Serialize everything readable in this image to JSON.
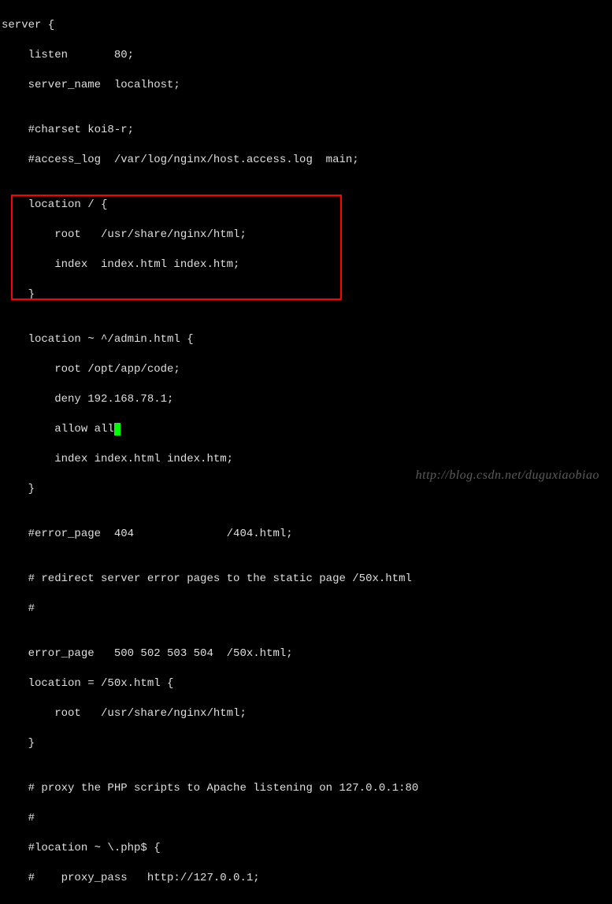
{
  "code": {
    "l01": "server {",
    "l02": "    listen       80;",
    "l03": "    server_name  localhost;",
    "l04": "",
    "l05": "    #charset koi8-r;",
    "l06": "    #access_log  /var/log/nginx/host.access.log  main;",
    "l07": "",
    "l08": "    location / {",
    "l09": "        root   /usr/share/nginx/html;",
    "l10": "        index  index.html index.htm;",
    "l11": "    }",
    "l12": "",
    "l13": "    location ~ ^/admin.html {",
    "l14": "        root /opt/app/code;",
    "l15": "        deny 192.168.78.1;",
    "l16a": "        allow all",
    "l16b": ";",
    "l17": "        index index.html index.htm;",
    "l18": "    }",
    "l19": "",
    "l20": "    #error_page  404              /404.html;",
    "l21": "",
    "l22": "    # redirect server error pages to the static page /50x.html",
    "l23": "    #",
    "l24": "",
    "l25": "    error_page   500 502 503 504  /50x.html;",
    "l26": "    location = /50x.html {",
    "l27": "        root   /usr/share/nginx/html;",
    "l28": "    }",
    "l29": "",
    "l30": "    # proxy the PHP scripts to Apache listening on 127.0.0.1:80",
    "l31": "    #",
    "l32": "    #location ~ \\.php$ {",
    "l33": "    #    proxy_pass   http://127.0.0.1;"
  },
  "watermark": "http://blog.csdn.net/duguxiaobiao"
}
